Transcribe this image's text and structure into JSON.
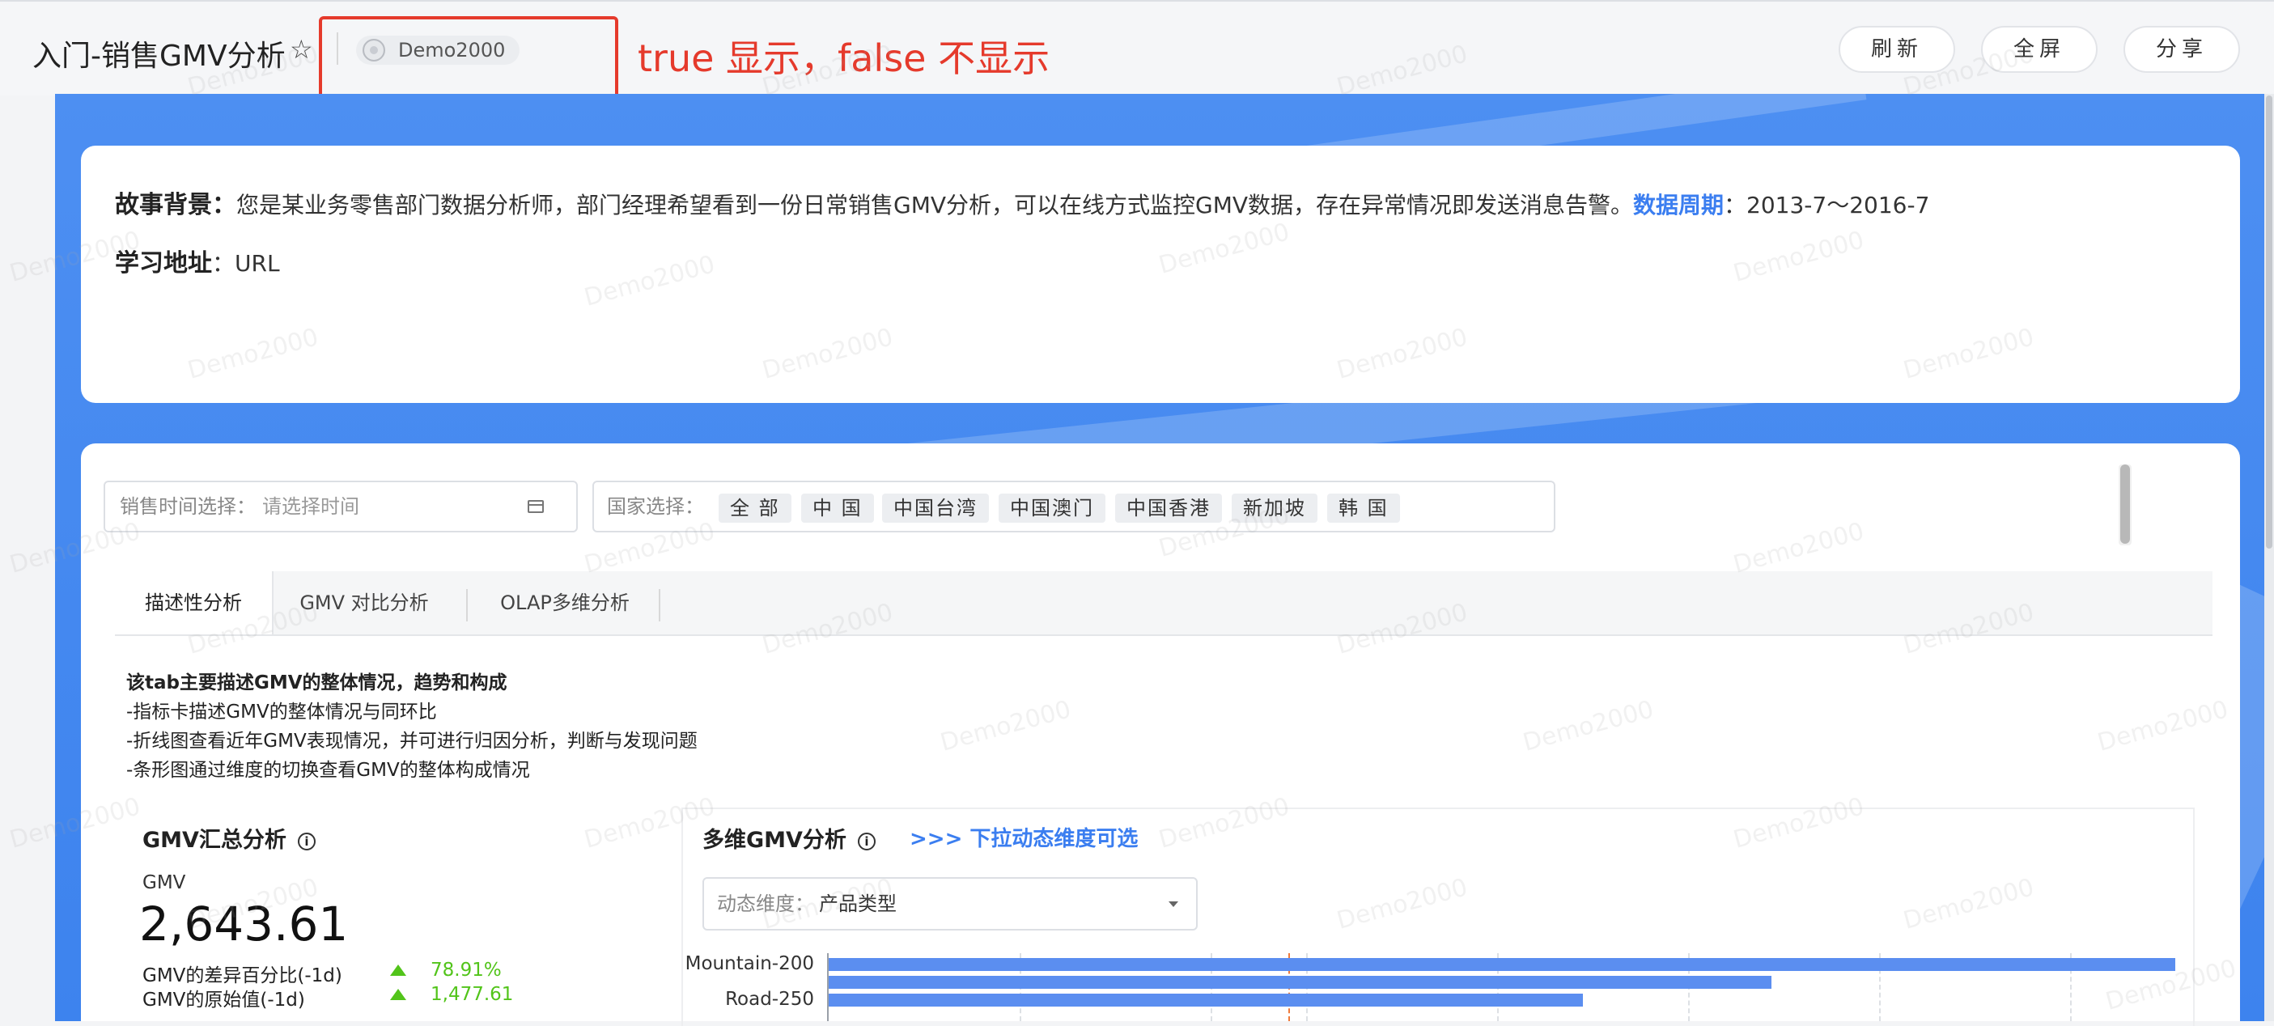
{
  "header": {
    "title": "入门-销售GMV分析",
    "user": "Demo2000",
    "annotation": "true 显示，false 不显示",
    "buttons": {
      "refresh": "刷新",
      "fullscreen": "全屏",
      "share": "分享"
    }
  },
  "story": {
    "bg_label": "故事背景：",
    "bg_text": "您是某业务零售部门数据分析师，部门经理希望看到一份日常销售GMV分析，可以在线方式监控GMV数据，存在异常情况即发送消息告警。",
    "period_label": "数据周期",
    "period_value": "：2013-7～2016-7",
    "url_label": "学习地址",
    "url_value": "：URL"
  },
  "filters": {
    "time_label": "销售时间选择：",
    "time_placeholder": "请选择时间",
    "country_label": "国家选择：",
    "countries": [
      "全 部",
      "中 国",
      "中国台湾",
      "中国澳门",
      "中国香港",
      "新加坡",
      "韩 国"
    ]
  },
  "tabs": [
    "描述性分析",
    "GMV 对比分析",
    "OLAP多维分析"
  ],
  "description": {
    "heading": "该tab主要描述GMV的整体情况，趋势和构成",
    "lines": [
      "-指标卡描述GMV的整体情况与同环比",
      "-折线图查看近年GMV表现情况，并可进行归因分析，判断与发现问题",
      "-条形图通过维度的切换查看GMV的整体构成情况"
    ]
  },
  "kpi": {
    "title": "GMV汇总分析",
    "label": "GMV",
    "value": "2,643.61",
    "rows": [
      {
        "label": "GMV的差异百分比(-1d)",
        "value": "78.91%"
      },
      {
        "label": "GMV的原始值(-1d)",
        "value": "1,477.61"
      }
    ]
  },
  "multidim": {
    "title": "多维GMV分析",
    "hint": ">>> 下拉动态维度可选",
    "select_label": "动态维度：",
    "select_value": "产品类型"
  },
  "chart_data": {
    "type": "bar",
    "orientation": "horizontal",
    "categories": [
      "Mountain-200",
      "",
      "Road-250"
    ],
    "values": [
      100,
      70,
      56
    ],
    "note": "values are relative bar lengths (axis ticks not visible in crop)"
  },
  "colors": {
    "accent": "#3b7ef0",
    "bar": "#5b8ef0",
    "positive": "#52c41a",
    "annotation": "#e53a2c",
    "canvas": "#4d8ff2"
  },
  "watermark": "Demo2000"
}
